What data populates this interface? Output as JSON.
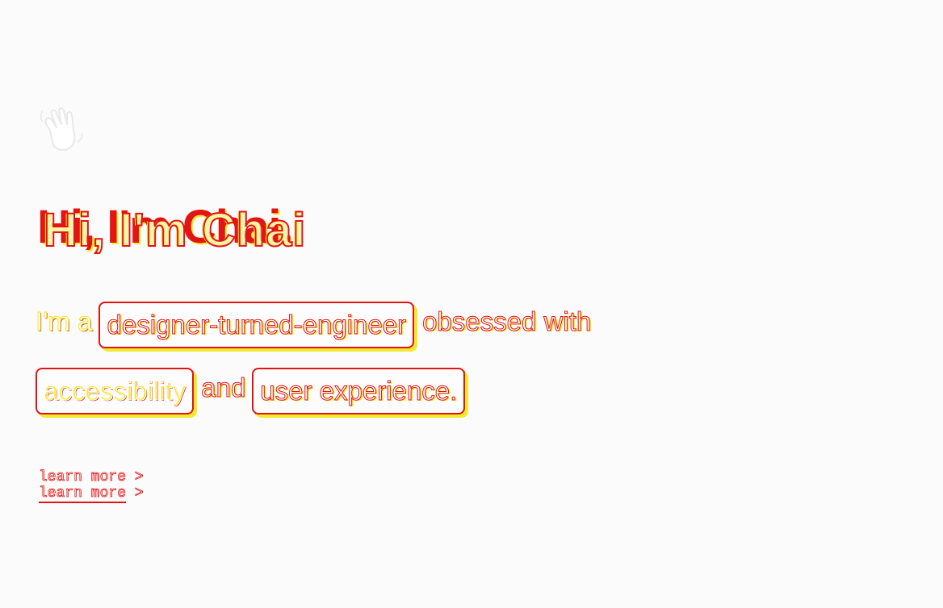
{
  "hero": {
    "wave_icon": "waving-hand-icon",
    "title_primary": "Hi, I'm Chai.",
    "title_echo": "Hi, I'm Chai",
    "intro": {
      "prefix": "I'm a",
      "chip_role": "designer-turned-engineer",
      "middle": "obsessed with",
      "chip_topic_1": "accessibility",
      "conjunction": "and",
      "chip_topic_2": "user experience."
    },
    "learn_more_text": "learn more",
    "learn_more_arrow": ">"
  },
  "colors": {
    "background": "#fbfbfb",
    "accent_red": "#e21414",
    "accent_yellow": "#f2ea2a"
  }
}
